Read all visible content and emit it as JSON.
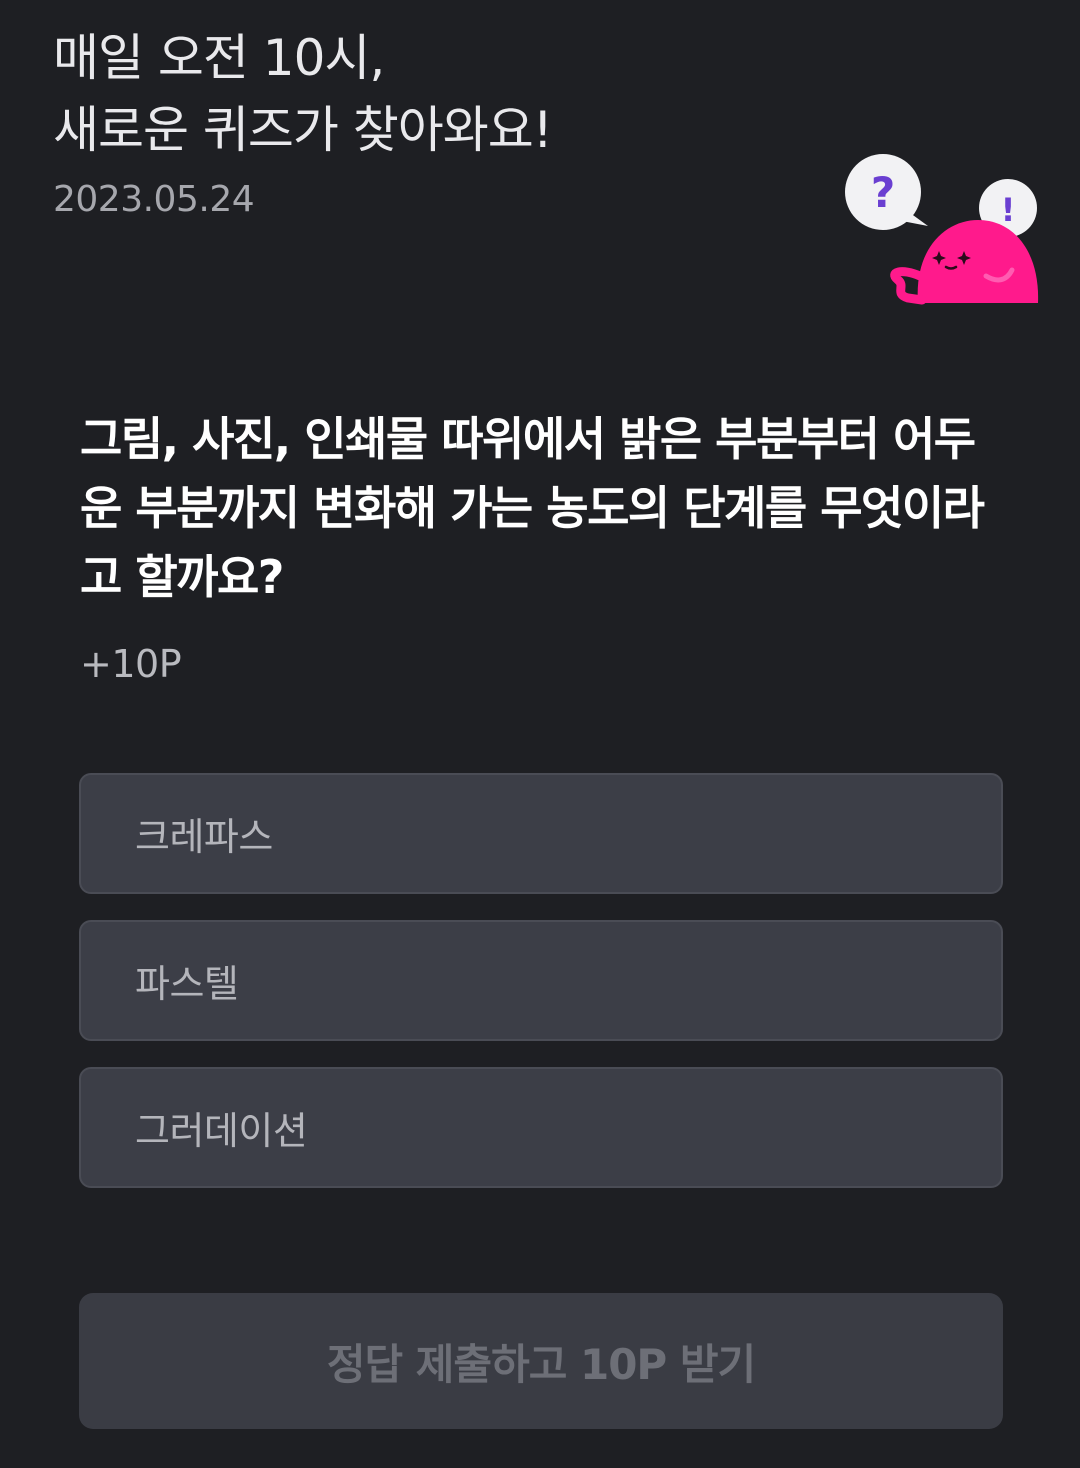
{
  "header": {
    "title_line1": "매일 오전 10시,",
    "title_line2": "새로운 퀴즈가 찾아와요!",
    "date": "2023.05.24"
  },
  "mascot": {
    "bubble_left_symbol": "?",
    "bubble_right_symbol": "!",
    "colors": {
      "body": "#ff1a8c",
      "bubble": "#f2f2f4",
      "symbol": "#6a3fd1"
    }
  },
  "quiz": {
    "question": "그림, 사진, 인쇄물 따위에서 밝은 부분부터 어두운 부분까지 변화해 가는 농도의 단계를 무엇이라고 할까요?",
    "points": "+10P",
    "options": [
      {
        "label": "크레파스"
      },
      {
        "label": "파스텔"
      },
      {
        "label": "그러데이션"
      }
    ]
  },
  "submit": {
    "label": "정답 제출하고 10P 받기",
    "state": "disabled"
  }
}
